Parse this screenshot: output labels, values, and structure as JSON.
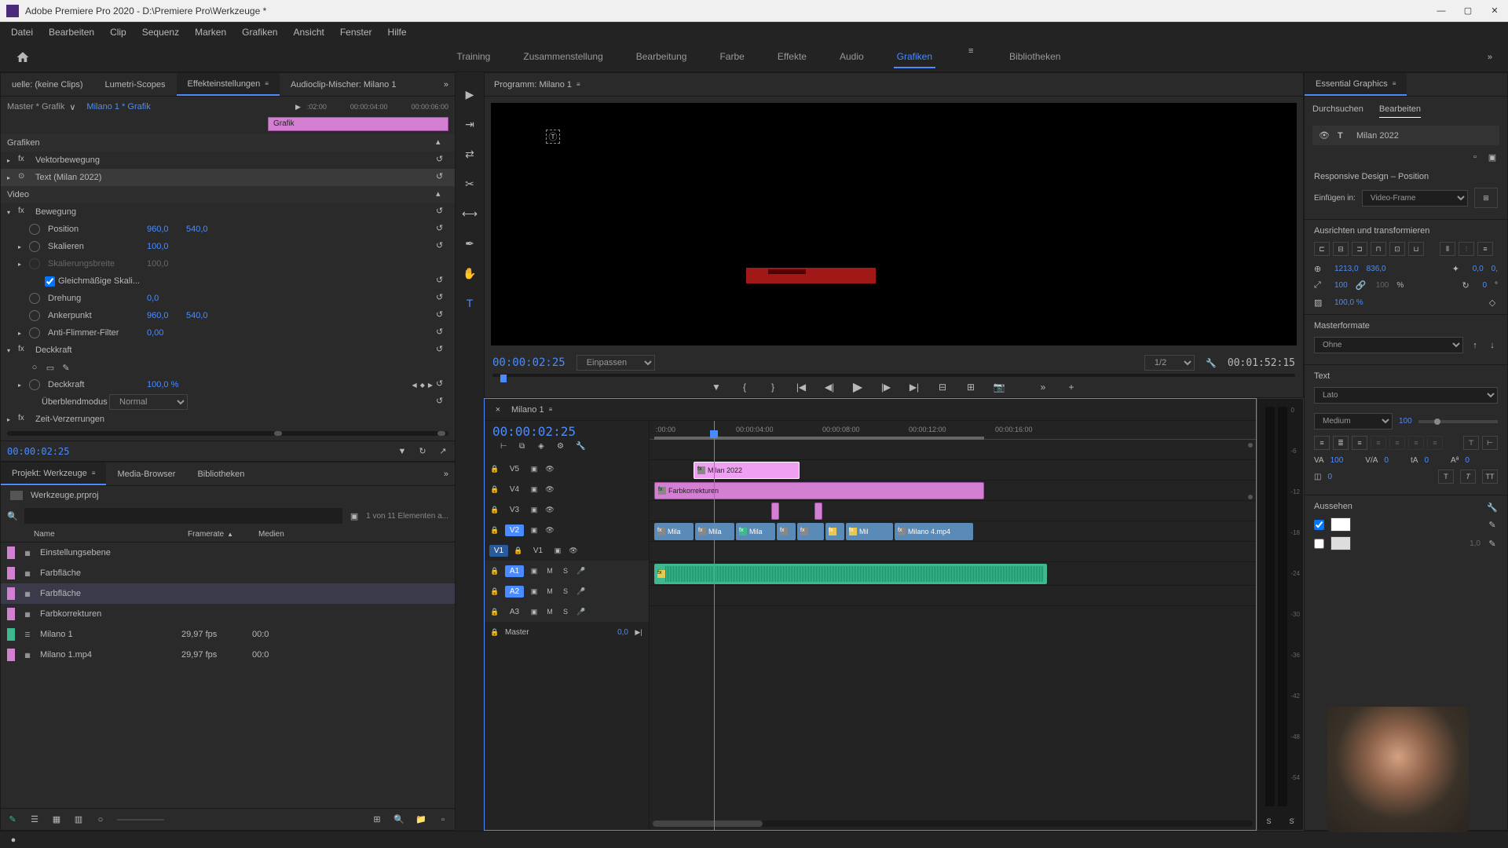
{
  "titlebar": {
    "title": "Adobe Premiere Pro 2020 - D:\\Premiere Pro\\Werkzeuge *"
  },
  "menubar": {
    "items": [
      "Datei",
      "Bearbeiten",
      "Clip",
      "Sequenz",
      "Marken",
      "Grafiken",
      "Ansicht",
      "Fenster",
      "Hilfe"
    ]
  },
  "workspaces": {
    "items": [
      "Training",
      "Zusammenstellung",
      "Bearbeitung",
      "Farbe",
      "Effekte",
      "Audio",
      "Grafiken",
      "Bibliotheken"
    ],
    "active": "Grafiken"
  },
  "source_panel": {
    "tabs": [
      "uelle: (keine Clips)",
      "Lumetri-Scopes",
      "Effekteinstellungen",
      "Audioclip-Mischer: Milano 1"
    ],
    "active_tab": "Effekteinstellungen",
    "master": "Master * Grafik",
    "instance": "Milano 1 * Grafik",
    "ruler_ticks": [
      ":02:00",
      "00:00:04:00",
      "00:00:06:00"
    ],
    "graphic_label": "Grafik",
    "sections": {
      "grafiken": "Grafiken",
      "video": "Video"
    },
    "effects": {
      "vektorbewegung": "Vektorbewegung",
      "text": "Text (Milan 2022)",
      "bewegung": "Bewegung",
      "position": "Position",
      "position_x": "960,0",
      "position_y": "540,0",
      "skalieren": "Skalieren",
      "skalieren_val": "100,0",
      "skalierungsbreite": "Skalierungsbreite",
      "skalierungsbreite_val": "100,0",
      "gleichmassig": "Gleichmäßige Skali...",
      "drehung": "Drehung",
      "drehung_val": "0,0",
      "ankerpunkt": "Ankerpunkt",
      "ankerpunkt_x": "960,0",
      "ankerpunkt_y": "540,0",
      "antiflimmer": "Anti-Flimmer-Filter",
      "antiflimmer_val": "0,00",
      "deckkraft": "Deckkraft",
      "deckkraft_prop": "Deckkraft",
      "deckkraft_val": "100,0 %",
      "blendmode": "Überblendmodus",
      "blendmode_val": "Normal",
      "zeitverzerrung": "Zeit-Verzerrungen"
    },
    "footer_tc": "00:00:02:25"
  },
  "project_panel": {
    "tabs": [
      "Projekt: Werkzeuge",
      "Media-Browser",
      "Bibliotheken"
    ],
    "active_tab": "Projekt: Werkzeuge",
    "project_name": "Werkzeuge.prproj",
    "search_placeholder": "",
    "item_count": "1 von 11 Elementen a...",
    "columns": {
      "name": "Name",
      "framerate": "Framerate",
      "media": "Medien"
    },
    "items": [
      {
        "color": "#d380d3",
        "name": "Einstellungsebene",
        "fr": "",
        "media": ""
      },
      {
        "color": "#d380d3",
        "name": "Farbfläche",
        "fr": "",
        "media": ""
      },
      {
        "color": "#d380d3",
        "name": "Farbfläche",
        "fr": "",
        "media": "",
        "selected": true
      },
      {
        "color": "#d380d3",
        "name": "Farbkorrekturen",
        "fr": "",
        "media": ""
      },
      {
        "color": "#3eb88e",
        "name": "Milano 1",
        "fr": "29,97 fps",
        "media": "00:0"
      },
      {
        "color": "#d380d3",
        "name": "Milano 1.mp4",
        "fr": "29,97 fps",
        "media": "00:0"
      }
    ]
  },
  "program_panel": {
    "title": "Programm: Milano 1",
    "tc_left": "00:00:02:25",
    "fit": "Einpassen",
    "zoom": "1/2",
    "tc_right": "00:01:52:15"
  },
  "timeline": {
    "seq_name": "Milano 1",
    "tc": "00:00:02:25",
    "ruler": [
      ":00:00",
      "00:00:04:00",
      "00:00:08:00",
      "00:00:12:00",
      "00:00:16:00"
    ],
    "video_tracks": [
      "V5",
      "V4",
      "V3",
      "V2",
      "V1"
    ],
    "v1_patch": "V1",
    "audio_tracks": [
      "A1",
      "A2",
      "A3"
    ],
    "master": "Master",
    "master_val": "0,0",
    "mute": "M",
    "solo": "S",
    "clips": {
      "v4_milan": "Milan 2022",
      "v3_farb": "Farbkorrekturen",
      "v1_mila": "Mila",
      "v1_mil": "Mil",
      "v1_milano4": "Milano 4.mp4"
    },
    "meter_scale": [
      "0",
      "-6",
      "-12",
      "-18",
      "-24",
      "-30",
      "-36",
      "-42",
      "-48",
      "-54",
      "--"
    ],
    "meter_s": "S"
  },
  "essential_graphics": {
    "title": "Essential Graphics",
    "tabs": [
      "Durchsuchen",
      "Bearbeiten"
    ],
    "active_tab": "Bearbeiten",
    "layer_name": "Milan 2022",
    "responsive_title": "Responsive Design – Position",
    "pin_to_label": "Einfügen in:",
    "pin_to_value": "Video-Frame",
    "align_title": "Ausrichten und transformieren",
    "pos_x": "1213,0",
    "pos_y": "836,0",
    "anchor_x": "0,0",
    "anchor_y": "0,",
    "scale": "100",
    "scale_h": "100",
    "percent": "%",
    "rotate": "0",
    "rotate_suffix": "°",
    "opacity": "100,0 %",
    "master_title": "Masterformate",
    "master_val": "Ohne",
    "text_title": "Text",
    "font": "Lato",
    "weight": "Medium",
    "size": "100",
    "tracking": "100",
    "kerning": "0",
    "leading": "0",
    "baseline": "0",
    "appearance_title": "Aussehen",
    "stroke_width": "1,0"
  }
}
